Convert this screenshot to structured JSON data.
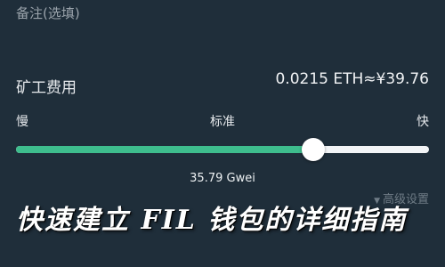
{
  "remark_placeholder": "备注(选填)",
  "fee": {
    "label": "矿工费用",
    "value": "0.0215 ETH≈¥39.76"
  },
  "speed": {
    "slow": "慢",
    "standard": "标准",
    "fast": "快",
    "level": 0.72,
    "gas_price": "35.79 Gwei"
  },
  "advanced_settings": "高级设置",
  "overlay_title": "快速建立 FIL 钱包的详细指南",
  "colors": {
    "background": "#1f2e3a",
    "slider_fill": "#3ebd8d",
    "slider_track": "#f2f4f6"
  }
}
